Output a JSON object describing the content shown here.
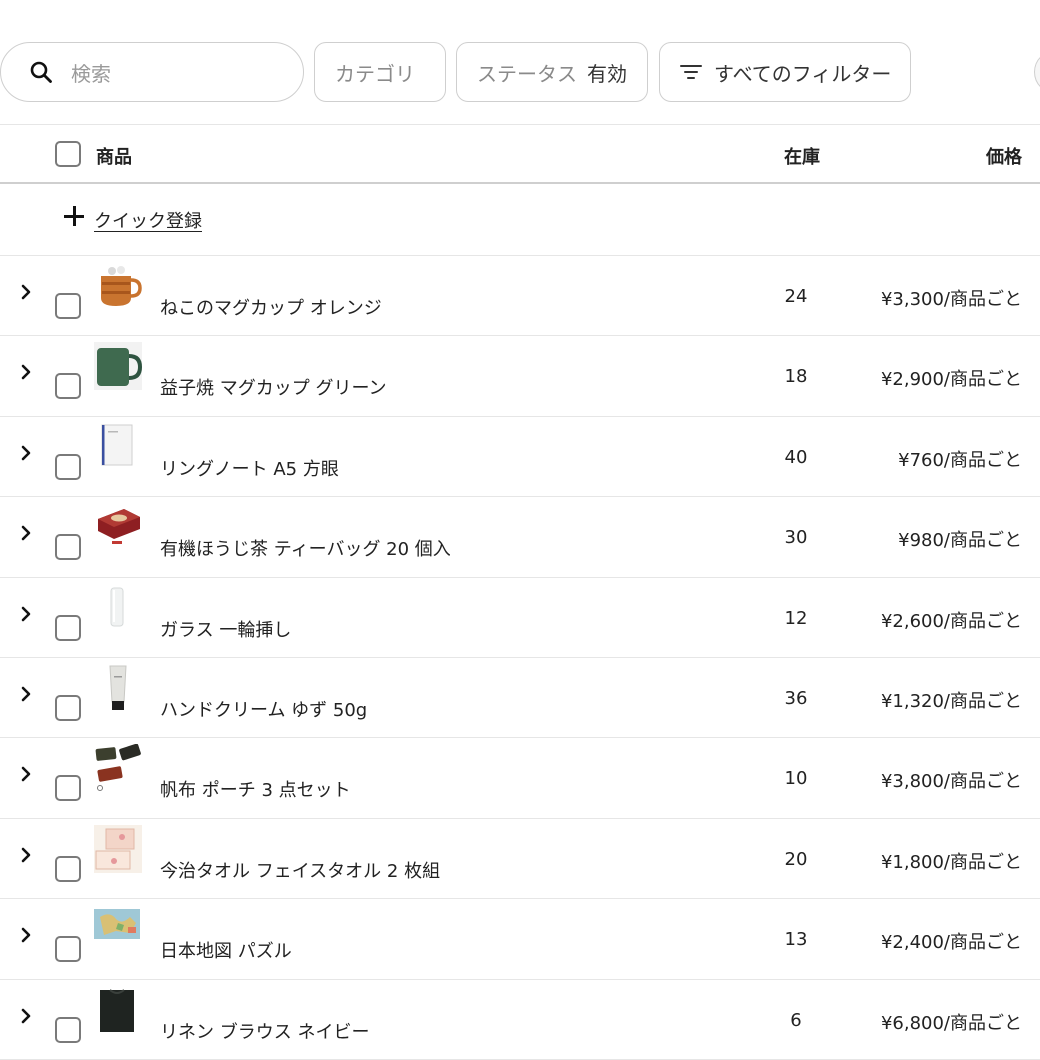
{
  "filters": {
    "search_placeholder": "検索",
    "category_label": "カテゴリ",
    "status_label": "ステータス",
    "status_value": "有効",
    "all_filters_label": "すべてのフィルター"
  },
  "table": {
    "columns": {
      "product": "商品",
      "stock": "在庫",
      "price": "価格"
    },
    "quick_add_label": "クイック登録",
    "rows": [
      {
        "name": "ねこのマグカップ オレンジ",
        "stock": "24",
        "price": "¥3,300/商品ごと",
        "thumb": "orange-cat-mug"
      },
      {
        "name": "益子焼 マグカップ グリーン",
        "stock": "18",
        "price": "¥2,900/商品ごと",
        "thumb": "green-mug"
      },
      {
        "name": "リングノート A5 方眼",
        "stock": "40",
        "price": "¥760/商品ごと",
        "thumb": "ring-notebook"
      },
      {
        "name": "有機ほうじ茶 ティーバッグ 20 個入",
        "stock": "30",
        "price": "¥980/商品ごと",
        "thumb": "tea-tin"
      },
      {
        "name": "ガラス 一輪挿し",
        "stock": "12",
        "price": "¥2,600/商品ごと",
        "thumb": "glass-vase"
      },
      {
        "name": "ハンドクリーム ゆず 50g",
        "stock": "36",
        "price": "¥1,320/商品ごと",
        "thumb": "hand-cream-tube"
      },
      {
        "name": "帆布 ポーチ 3 点セット",
        "stock": "10",
        "price": "¥3,800/商品ごと",
        "thumb": "canvas-pouches"
      },
      {
        "name": "今治タオル フェイスタオル 2 枚組",
        "stock": "20",
        "price": "¥1,800/商品ごと",
        "thumb": "towel-box"
      },
      {
        "name": "日本地図 パズル",
        "stock": "13",
        "price": "¥2,400/商品ごと",
        "thumb": "map-puzzle"
      },
      {
        "name": "リネン ブラウス ネイビー",
        "stock": "6",
        "price": "¥6,800/商品ごと",
        "thumb": "navy-blouse"
      }
    ]
  }
}
